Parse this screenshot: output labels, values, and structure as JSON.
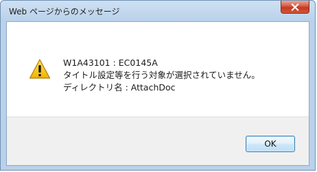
{
  "window": {
    "title": "Web ページからのメッセージ"
  },
  "icons": {
    "close": "close-icon",
    "warning": "warning-icon"
  },
  "message": {
    "lines": [
      "W1A43101 : EC0145A",
      "タイトル設定等を行う対象が選択されていません。",
      "ディレクトリ名 : AttachDoc"
    ]
  },
  "buttons": {
    "ok_label": "OK"
  },
  "colors": {
    "titlebar": "#b9d1ea",
    "close_button": "#c7452b",
    "warning_fill": "#f5c400",
    "footer": "#f0f0f0"
  }
}
